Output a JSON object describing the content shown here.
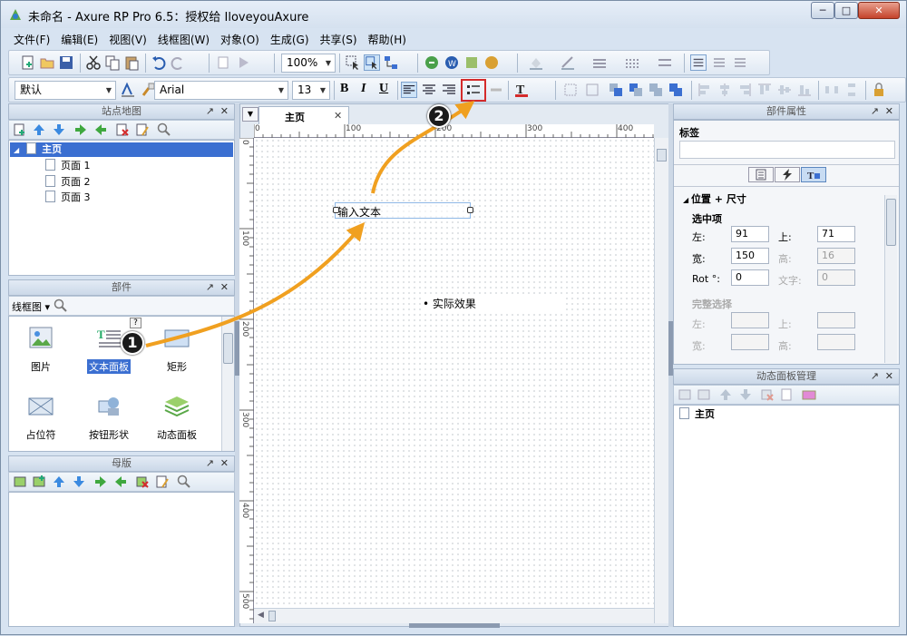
{
  "window": {
    "title": "未命名 - Axure RP Pro 6.5：授权给 IloveyouAxure"
  },
  "menu": [
    "文件(F)",
    "编辑(E)",
    "视图(V)",
    "线框图(W)",
    "对象(O)",
    "生成(G)",
    "共享(S)",
    "帮助(H)"
  ],
  "toolbar": {
    "zoom": "100%",
    "style": "默认",
    "font": "Arial",
    "font_size": "13",
    "bold": "B",
    "italic": "I",
    "underline": "U",
    "text_color": "T"
  },
  "sitemap": {
    "title": "站点地图",
    "root": "主页",
    "pages": [
      "页面 1",
      "页面 2",
      "页面 3"
    ]
  },
  "widgets": {
    "title": "部件",
    "library": "线框图",
    "items": [
      "图片",
      "文本面板",
      "矩形",
      "占位符",
      "按钮形状",
      "动态面板"
    ]
  },
  "masters": {
    "title": "母版"
  },
  "editor": {
    "tab": "主页",
    "ruler_h": [
      "0",
      "100",
      "200",
      "300",
      "400"
    ],
    "ruler_v": [
      "0",
      "100",
      "200",
      "300",
      "400",
      "500"
    ],
    "textbox_text": "输入文本",
    "bullet_text": "• 实际效果"
  },
  "props": {
    "title": "部件属性",
    "label_title": "标签",
    "section": "位置 + 尺寸",
    "selected": "选中项",
    "left_label": "左:",
    "left": "91",
    "top_label": "上:",
    "top": "71",
    "width_label": "宽:",
    "width": "150",
    "height_label": "高:",
    "height": "16",
    "rot_label": "Rot °:",
    "rot": "0",
    "text_label": "文字:",
    "text_rot": "0",
    "full_select": "完整选择",
    "fs_left": "左:",
    "fs_top": "上:",
    "fs_width": "宽:",
    "fs_height": "高:"
  },
  "dynamic_panel": {
    "title": "动态面板管理",
    "root": "主页"
  },
  "annotations": {
    "one": "1",
    "two": "2"
  },
  "colors": {
    "accent": "#f0a020",
    "selection": "#3b6fd1",
    "highlight_box": "#d42b2b"
  }
}
